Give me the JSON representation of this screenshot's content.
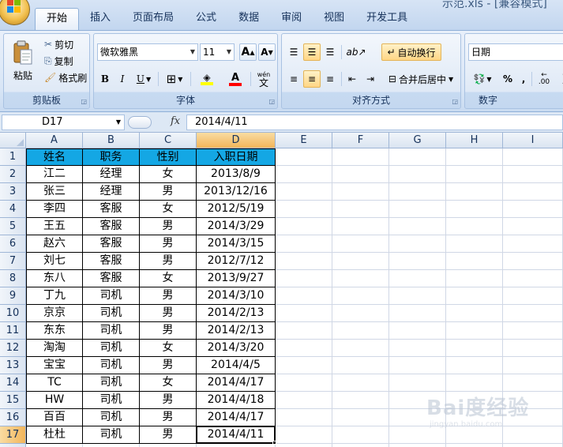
{
  "window": {
    "title": "示范.xls - [兼容模式]"
  },
  "tabs": [
    {
      "label": "开始",
      "active": true
    },
    {
      "label": "插入"
    },
    {
      "label": "页面布局"
    },
    {
      "label": "公式"
    },
    {
      "label": "数据"
    },
    {
      "label": "审阅"
    },
    {
      "label": "视图"
    },
    {
      "label": "开发工具"
    }
  ],
  "ribbon": {
    "clipboard": {
      "label": "剪贴板",
      "paste": "粘贴",
      "cut": "剪切",
      "copy": "复制",
      "format_painter": "格式刷"
    },
    "font": {
      "label": "字体",
      "font_name": "微软雅黑",
      "font_size": "11",
      "bold": "B",
      "italic": "I",
      "underline": "U",
      "grow": "A",
      "shrink": "A",
      "phonetic": "wén",
      "font_color": "A"
    },
    "alignment": {
      "label": "对齐方式",
      "wrap_text": "自动换行",
      "merge_center": "合并后居中"
    },
    "number": {
      "label": "数字",
      "format": "日期",
      "percent": "%",
      "comma": ",",
      "inc_decimal": ".00",
      "dec_decimal": ".0"
    }
  },
  "formula_bar": {
    "name_box": "D17",
    "fx": "fx",
    "formula": "2014/4/11"
  },
  "columns": [
    "A",
    "B",
    "C",
    "D",
    "E",
    "F",
    "G",
    "H",
    "I"
  ],
  "header_row": [
    "姓名",
    "职务",
    "性别",
    "入职日期"
  ],
  "rows": [
    [
      "江二",
      "经理",
      "女",
      "2013/8/9"
    ],
    [
      "张三",
      "经理",
      "男",
      "2013/12/16"
    ],
    [
      "李四",
      "客服",
      "女",
      "2012/5/19"
    ],
    [
      "王五",
      "客服",
      "男",
      "2014/3/29"
    ],
    [
      "赵六",
      "客服",
      "男",
      "2014/3/15"
    ],
    [
      "刘七",
      "客服",
      "男",
      "2012/7/12"
    ],
    [
      "东八",
      "客服",
      "女",
      "2013/9/27"
    ],
    [
      "丁九",
      "司机",
      "男",
      "2014/3/10"
    ],
    [
      "京京",
      "司机",
      "男",
      "2014/2/13"
    ],
    [
      "东东",
      "司机",
      "男",
      "2014/2/13"
    ],
    [
      "淘淘",
      "司机",
      "女",
      "2014/3/20"
    ],
    [
      "宝宝",
      "司机",
      "男",
      "2014/4/5"
    ],
    [
      "TC",
      "司机",
      "女",
      "2014/4/17"
    ],
    [
      "HW",
      "司机",
      "男",
      "2014/4/18"
    ],
    [
      "百百",
      "司机",
      "男",
      "2014/4/17"
    ],
    [
      "杜杜",
      "司机",
      "男",
      "2014/4/11"
    ]
  ],
  "row_numbers": [
    "1",
    "2",
    "3",
    "4",
    "5",
    "6",
    "7",
    "8",
    "9",
    "10",
    "11",
    "12",
    "13",
    "14",
    "15",
    "16",
    "17"
  ],
  "selection": {
    "cell": "D17",
    "column": "D",
    "row": "17"
  },
  "colors": {
    "header_fill": "#14a7e4",
    "selection_header": "#f2b55a",
    "ribbon": "#dfe9f6"
  },
  "watermark": {
    "text": "Bai度经验",
    "sub": "jingyan.baidu.com"
  }
}
